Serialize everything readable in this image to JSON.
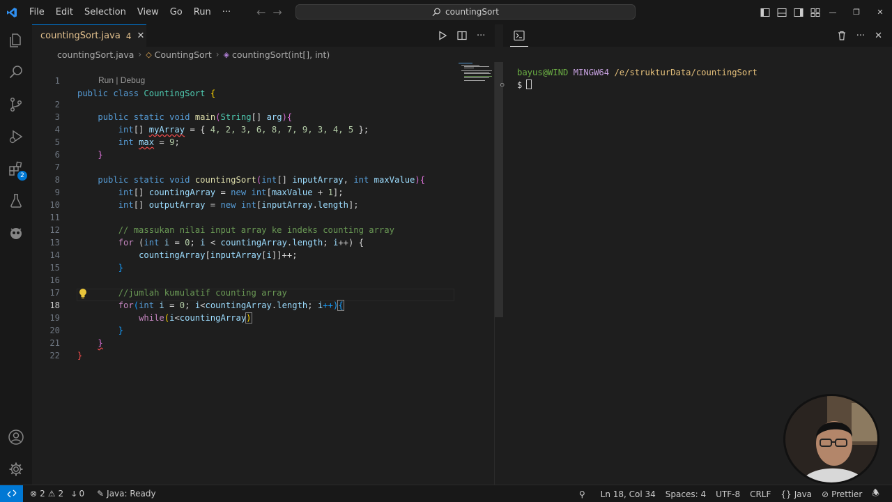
{
  "menu": [
    "File",
    "Edit",
    "Selection",
    "View",
    "Go",
    "Run",
    "···"
  ],
  "search": {
    "text": "countingSort"
  },
  "tab": {
    "label": "countingSort.java",
    "problems": "4"
  },
  "breadcrumb": {
    "file": "countingSort.java",
    "class": "CountingSort",
    "method": "countingSort(int[], int)"
  },
  "codelens": "Run | Debug",
  "line_numbers": [
    "1",
    "2",
    "3",
    "4",
    "5",
    "6",
    "7",
    "8",
    "9",
    "10",
    "11",
    "12",
    "13",
    "14",
    "15",
    "16",
    "17",
    "18",
    "19",
    "20",
    "21",
    "22"
  ],
  "code": {
    "l1": {
      "kw1": "public",
      "kw2": "class",
      "cls": "CountingSort",
      "br": "{"
    },
    "l2": {
      "kw1": "public",
      "kw2": "static",
      "kw3": "void",
      "fn": "main",
      "p1": "(",
      "ty": "String",
      "p2": "[] ",
      "vr": "arg",
      "p3": "){"
    },
    "l3": {
      "kw": "int",
      "p1": "[] ",
      "vr": "myArray",
      "p2": " = { ",
      "vals": "4, 2, 3, 6, 8, 7, 9, 3, 4, 5",
      "p3": " };"
    },
    "l4": {
      "kw": "int",
      "vr": "max",
      "p1": " = ",
      "nm": "9",
      "p2": ";"
    },
    "l5": {
      "br": "}"
    },
    "l7": {
      "kw1": "public",
      "kw2": "static",
      "kw3": "void",
      "fn": "countingSort",
      "p1": "(",
      "kw4": "int",
      "p2": "[] ",
      "vr1": "inputArray",
      "p3": ", ",
      "kw5": "int",
      "vr2": "maxValue",
      "p4": "){"
    },
    "l8": {
      "kw": "int",
      "p1": "[] ",
      "vr1": "countingArray",
      "p2": " = ",
      "kw2": "new",
      "kw3": "int",
      "p3": "[",
      "vr2": "maxValue",
      "p4": " + ",
      "nm": "1",
      "p5": "];"
    },
    "l9": {
      "kw": "int",
      "p1": "[] ",
      "vr1": "outputArray",
      "p2": " = ",
      "kw2": "new",
      "kw3": "int",
      "p3": "[",
      "vr2": "inputArray",
      "p4": ".",
      "vr3": "length",
      "p5": "];"
    },
    "l11": {
      "cm": "// massukan nilai input array ke indeks counting array"
    },
    "l12": {
      "ctl": "for",
      "p1": " (",
      "kw": "int",
      "vr1": "i",
      "p2": " = ",
      "nm": "0",
      "p3": "; ",
      "vr2": "i",
      "p4": " < ",
      "vr3": "countingArray",
      "p5": ".",
      "vr4": "length",
      "p6": "; ",
      "vr5": "i",
      "p7": "++) {"
    },
    "l13": {
      "vr1": "countingArray",
      "p1": "[",
      "vr2": "inputArray",
      "p2": "[",
      "vr3": "i",
      "p3": "]]++;"
    },
    "l14": {
      "br": "}"
    },
    "l16": {
      "cm": "//jumlah kumulatif counting array"
    },
    "l17": {
      "ctl": "for",
      "p1": "(",
      "kw": "int",
      "vr1": "i",
      "p2": " = ",
      "nm": "0",
      "p3": "; ",
      "vr2": "i",
      "p4": "<",
      "vr3": "countingArray",
      "p5": ".",
      "vr4": "length",
      "p6": "; ",
      "vr5": "i",
      "p7": "++)",
      "br": "{"
    },
    "l18": {
      "ctl": "while",
      "br1": "(",
      "vr1": "i",
      "p1": "<",
      "vr2": "countingArray",
      "br2": ")"
    },
    "l19": {
      "br": "}"
    },
    "l20": {
      "br": "}"
    },
    "l21": {
      "br": "}"
    }
  },
  "terminal": {
    "user": "bayus@WIND",
    "host": "MINGW64",
    "path": "/e/strukturData/countingSort",
    "prompt": "$"
  },
  "status": {
    "errors": "2",
    "warnings": "2",
    "ports": "0",
    "java": "Java: Ready",
    "position": "Ln 18, Col 34",
    "spaces": "Spaces: 4",
    "encoding": "UTF-8",
    "eol": "CRLF",
    "language": "Java",
    "formatter": "Prettier"
  },
  "colors": {
    "accent": "#0078d4",
    "background": "#1e1e1e",
    "chrome": "#181818"
  }
}
